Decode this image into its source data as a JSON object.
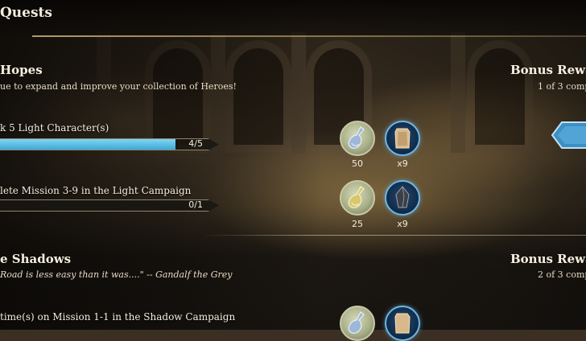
{
  "header": {
    "title": "Quests"
  },
  "sections": [
    {
      "title": "Hopes",
      "subtitle": "ue to expand and improve your collection of Heroes!",
      "bonus_title": "Bonus Rewa",
      "bonus_progress": "1 of 3 comp",
      "tasks": [
        {
          "label": "k 5 Light Character(s)",
          "progress_text": "4/5",
          "progress": 0.8,
          "rewards": [
            {
              "icon": "potion-icon",
              "amount": "50"
            },
            {
              "icon": "crystal-card-icon",
              "amount": "x9"
            }
          ]
        },
        {
          "label": "lete Mission 3-9 in the Light Campaign",
          "progress_text": "0/1",
          "progress": 0,
          "rewards": [
            {
              "icon": "potion-icon",
              "amount": "25"
            },
            {
              "icon": "dark-crystal-icon",
              "amount": "x9"
            }
          ]
        }
      ]
    },
    {
      "title": "e Shadows",
      "subtitle": "Road is less easy than it was....\" -- Gandalf the Grey",
      "bonus_title": "Bonus Rewa",
      "bonus_progress": "2 of 3 comp",
      "tasks": [
        {
          "label": "time(s) on Mission 1-1 in the Shadow Campaign",
          "progress_text": "",
          "progress": 0
        }
      ]
    }
  ],
  "colors": {
    "progress_fill": "#5bbde6",
    "card_border": "#6fb6e3",
    "claim_button": "#4aa3d6"
  }
}
